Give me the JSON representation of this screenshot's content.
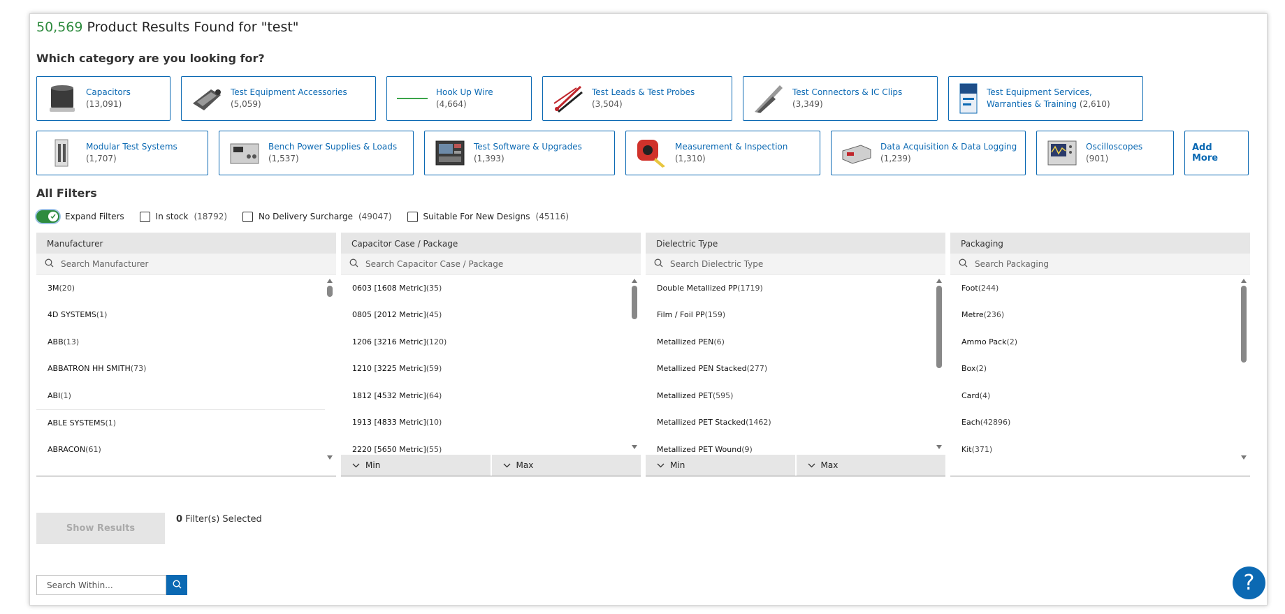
{
  "results": {
    "count": "50,569",
    "text": "Product Results Found for \"test\""
  },
  "category_heading": "Which category are you looking for?",
  "categories_row1": [
    {
      "label": "Capacitors",
      "count": "(13,091)",
      "icon": "capacitor-icon"
    },
    {
      "label": "Test Equipment Accessories",
      "count": "(5,059)",
      "icon": "probe-accessory-icon"
    },
    {
      "label": "Hook Up Wire",
      "count": "(4,664)",
      "icon": "wire-icon"
    },
    {
      "label": "Test Leads & Test Probes",
      "count": "(3,504)",
      "icon": "test-leads-icon"
    },
    {
      "label": "Test Connectors & IC Clips",
      "count": "(3,349)",
      "icon": "clip-icon"
    },
    {
      "label": "Test Equipment Services, Warranties & Training",
      "count": "(2,610)",
      "icon": "brochure-icon"
    }
  ],
  "categories_row2": [
    {
      "label": "Modular Test Systems",
      "count": "(1,707)",
      "icon": "modular-system-icon"
    },
    {
      "label": "Bench Power Supplies & Loads",
      "count": "(1,537)",
      "icon": "power-supply-icon"
    },
    {
      "label": "Test Software & Upgrades",
      "count": "(1,393)",
      "icon": "software-icon"
    },
    {
      "label": "Measurement & Inspection",
      "count": "(1,310)",
      "icon": "tape-measure-icon"
    },
    {
      "label": "Data Acquisition & Data Logging",
      "count": "(1,239)",
      "icon": "data-logger-icon"
    },
    {
      "label": "Oscilloscopes",
      "count": "(901)",
      "icon": "oscilloscope-icon"
    }
  ],
  "add_more": "Add More",
  "filters_heading": "All Filters",
  "filter_options": {
    "expand": "Expand Filters",
    "in_stock": "In stock",
    "in_stock_count": "(18792)",
    "no_surcharge": "No Delivery Surcharge",
    "no_surcharge_count": "(49047)",
    "new_designs": "Suitable For New Designs",
    "new_designs_count": "(45116)"
  },
  "panels": {
    "manufacturer": {
      "title": "Manufacturer",
      "placeholder": "Search Manufacturer",
      "items": [
        {
          "name": "3M",
          "count": "(20)"
        },
        {
          "name": "4D SYSTEMS",
          "count": "(1)"
        },
        {
          "name": "ABB",
          "count": "(13)"
        },
        {
          "name": "ABBATRON HH SMITH",
          "count": "(73)"
        },
        {
          "name": "ABI",
          "count": "(1)"
        },
        {
          "name": "ABLE SYSTEMS",
          "count": "(1)"
        },
        {
          "name": "ABRACON",
          "count": "(61)"
        }
      ]
    },
    "case": {
      "title": "Capacitor Case / Package",
      "placeholder": "Search Capacitor Case / Package",
      "items": [
        {
          "name": "0603 [1608 Metric]",
          "count": "(35)"
        },
        {
          "name": "0805 [2012 Metric]",
          "count": "(45)"
        },
        {
          "name": "1206 [3216 Metric]",
          "count": "(120)"
        },
        {
          "name": "1210 [3225 Metric]",
          "count": "(59)"
        },
        {
          "name": "1812 [4532 Metric]",
          "count": "(64)"
        },
        {
          "name": "1913 [4833 Metric]",
          "count": "(10)"
        },
        {
          "name": "2220 [5650 Metric]",
          "count": "(55)"
        }
      ],
      "min": "Min",
      "max": "Max"
    },
    "dielectric": {
      "title": "Dielectric Type",
      "placeholder": "Search Dielectric Type",
      "items": [
        {
          "name": "Double Metallized PP",
          "count": "(1719)"
        },
        {
          "name": "Film / Foil PP",
          "count": "(159)"
        },
        {
          "name": "Metallized PEN",
          "count": "(6)"
        },
        {
          "name": "Metallized PEN Stacked",
          "count": "(277)"
        },
        {
          "name": "Metallized PET",
          "count": "(595)"
        },
        {
          "name": "Metallized PET Stacked",
          "count": "(1462)"
        },
        {
          "name": "Metallized PET Wound",
          "count": "(9)"
        }
      ],
      "min": "Min",
      "max": "Max"
    },
    "packaging": {
      "title": "Packaging",
      "placeholder": "Search Packaging",
      "items": [
        {
          "name": "Foot",
          "count": "(244)"
        },
        {
          "name": "Metre",
          "count": "(236)"
        },
        {
          "name": "Ammo Pack",
          "count": "(2)"
        },
        {
          "name": "Box",
          "count": "(2)"
        },
        {
          "name": "Card",
          "count": "(4)"
        },
        {
          "name": "Each",
          "count": "(42896)"
        },
        {
          "name": "Kit",
          "count": "(371)"
        }
      ]
    }
  },
  "show_results": "Show Results",
  "selected_count": "0",
  "selected_text": "Filter(s) Selected",
  "search_within_placeholder": "Search Within...",
  "help": "?",
  "colors": {
    "accent": "#0b69b3",
    "count_green": "#2e8b3e",
    "toggle_green": "#2e8b3e"
  }
}
